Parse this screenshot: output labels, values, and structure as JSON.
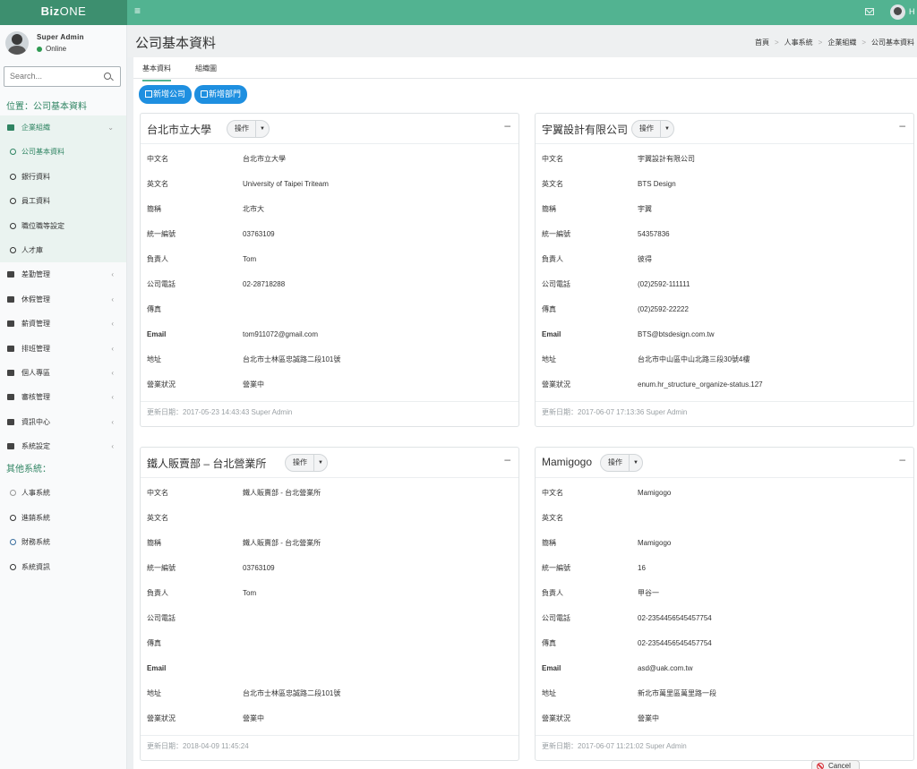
{
  "app": {
    "logo_bold": "Biz",
    "logo_rest": "ONE",
    "top_user_initial": "H"
  },
  "user": {
    "name": "Super Admin",
    "status": "Online"
  },
  "search": {
    "placeholder": "Search..."
  },
  "location": "位置：公司基本資料",
  "menu": {
    "group": "企業組織",
    "sub_items": [
      "公司基本資料",
      "銀行資料",
      "員工資料",
      "職位職等設定",
      "人才庫"
    ],
    "items": [
      "差勤管理",
      "休假管理",
      "薪資管理",
      "排班管理",
      "個人專區",
      "審核管理",
      "資訊中心",
      "系統設定"
    ],
    "other_head": "其他系統：",
    "other_items": [
      "人事系統",
      "進銷系統",
      "財務系統",
      "系統資訊"
    ]
  },
  "page": {
    "title": "公司基本資料"
  },
  "breadcrumb": [
    "首頁",
    "人事系統",
    "企業組織",
    "公司基本資料"
  ],
  "tabs": [
    "基本資料",
    "組織圖"
  ],
  "buttons": {
    "add_company": "新增公司",
    "add_dept": "新增部門"
  },
  "card_ui": {
    "op_label": "操作"
  },
  "field_labels": [
    "中文名",
    "英文名",
    "簡稱",
    "統一編號",
    "負責人",
    "公司電話",
    "傳真",
    "Email",
    "地址",
    "營業狀況"
  ],
  "cards": [
    {
      "title": "台北市立大學",
      "values": [
        "台北市立大學",
        "University of Taipei Triteam",
        "北市大",
        "03763109",
        "Tom",
        "02-28718288",
        "",
        "tom911072@gmail.com",
        "台北市士林區忠誠路二段101號",
        "營業中"
      ],
      "footer": "更新日期：2017-05-23 14:43:43 Super Admin"
    },
    {
      "title": "宇翼設計有限公司",
      "values": [
        "宇翼設計有限公司",
        "BTS Design",
        "宇翼",
        "54357836",
        "彼得",
        "(02)2592-111111",
        "(02)2592-22222",
        "BTS@btsdesign.com.tw",
        "台北市中山區中山北路三段30號4樓",
        "enum.hr_structure_organize-status.127"
      ],
      "footer": "更新日期：2017-06-07 17:13:36 Super Admin"
    },
    {
      "title": "鐵人販賣部 – 台北營業所",
      "values": [
        "鐵人販賣部 - 台北營業所",
        "",
        "鐵人販賣部 - 台北營業所",
        "03763109",
        "Tom",
        "",
        "",
        "",
        "台北市士林區忠誠路二段101號",
        "營業中"
      ],
      "footer": "更新日期：2018-04-09 11:45:24"
    },
    {
      "title": "Mamigogo",
      "values": [
        "Mamigogo",
        "",
        "Mamigogo",
        "16",
        "甲谷一",
        "02-2354456545457754",
        "02-2354456545457754",
        "asd@uak.com.tw",
        "新北市萬里區萬里路一段",
        "營業中"
      ],
      "footer": "更新日期：2017-06-07 11:21:02 Super Admin"
    }
  ],
  "cancel_label": "Cancel",
  "colors": {
    "topbar": "#52b391",
    "logo_bg": "#3d8f6f",
    "accent_green": "#2f8462",
    "button_blue": "#1e8fe0"
  }
}
